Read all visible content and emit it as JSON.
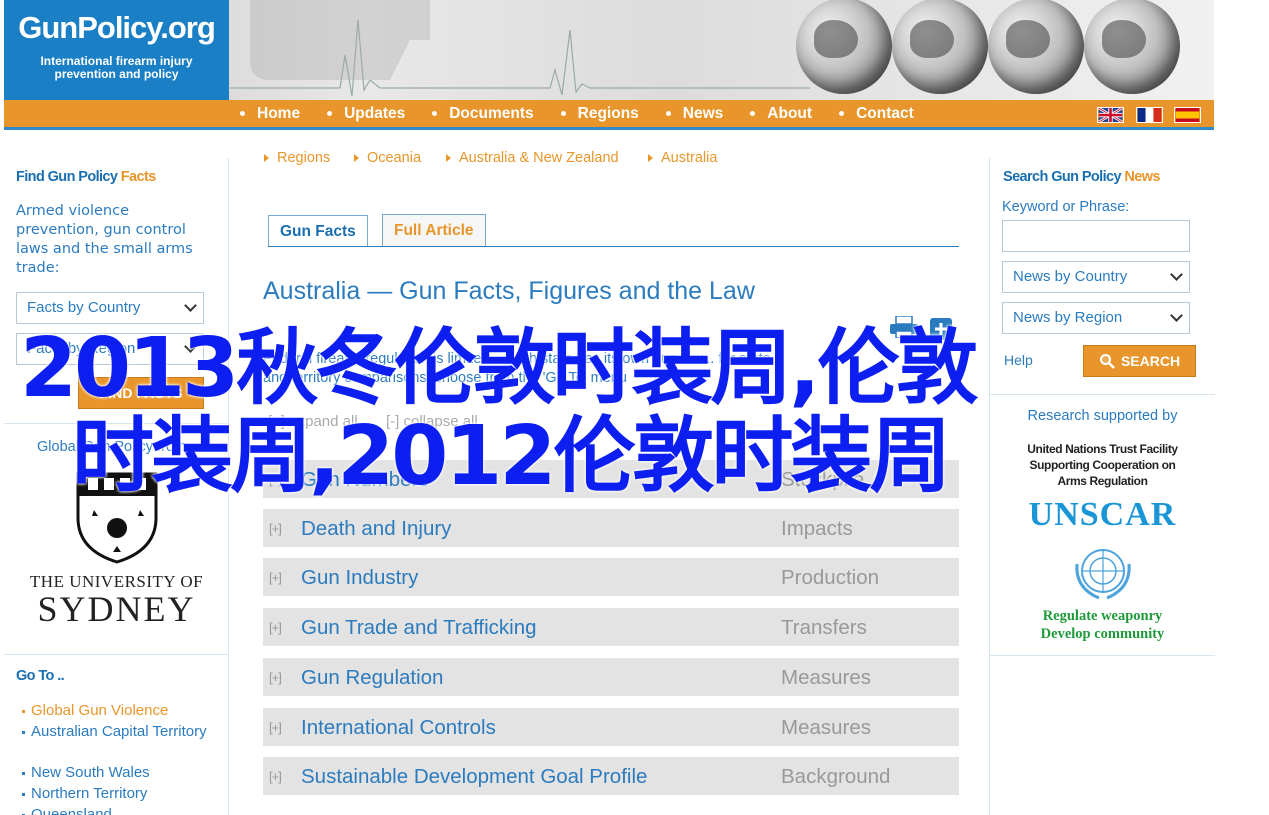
{
  "logo": {
    "title": "GunPolicy.org",
    "tagline_line1": "International firearm injury",
    "tagline_line2": "prevention and policy"
  },
  "nav": {
    "items": [
      "Home",
      "Updates",
      "Documents",
      "Regions",
      "News",
      "About",
      "Contact"
    ]
  },
  "flags": [
    "english-flag",
    "french-flag",
    "spanish-flag"
  ],
  "left": {
    "find_title_a": "Find Gun Policy ",
    "find_title_b": "Facts",
    "find_desc": "Armed violence prevention, gun control laws and the small arms trade:",
    "select1": "Facts by Country",
    "select2": "Facts by Region",
    "find_button": "FIND FACTS",
    "global_label": "Global Gun Policy from",
    "uni_line1": "THE UNIVERSITY OF",
    "uni_line2": "SYDNEY",
    "goto_title": "Go To ..",
    "goto_items": [
      "Global Gun Violence",
      "Australian Capital Territory",
      "New South Wales",
      "Northern Territory",
      "Queensland"
    ]
  },
  "breadcrumb": [
    "Regions",
    "Oceania",
    "Australia & New Zealand",
    "Australia"
  ],
  "tabs": [
    "Gun Facts",
    "Full Article"
  ],
  "page_title": "Australia — Gun Facts, Figures and the Law",
  "intro": "Federal firearm regulation is limited... each state has its own gun law... for state and territory comparisons, choose from the 'Go To' menu",
  "expand": "expand all",
  "collapse": "collapse all",
  "rows": [
    {
      "label": "Gun Numbers",
      "cat": "Stockpile"
    },
    {
      "label": "Death and Injury",
      "cat": "Impacts"
    },
    {
      "label": "Gun Industry",
      "cat": "Production"
    },
    {
      "label": "Gun Trade and Trafficking",
      "cat": "Transfers"
    },
    {
      "label": "Gun Regulation",
      "cat": "Measures"
    },
    {
      "label": "International Controls",
      "cat": "Measures"
    },
    {
      "label": "Sustainable Development Goal Profile",
      "cat": "Background"
    }
  ],
  "right": {
    "search_title_a": "Search Gun Policy ",
    "search_title_b": "News",
    "keyword_label": "Keyword or Phrase:",
    "keyword_value": "",
    "select1": "News by Country",
    "select2": "News by Region",
    "search_button": "SEARCH",
    "help": "Help",
    "research": "Research supported by",
    "un_line1": "United Nations Trust Facility",
    "un_line2": "Supporting Cooperation on",
    "un_line3": "Arms Regulation",
    "unscar": "UNSCAR",
    "reg1": "Regulate weaponry",
    "reg2": "Develop community"
  },
  "overlay": {
    "line1": "2013秋冬伦敦时装周,伦敦",
    "line2": "时装周,2012伦敦时装周"
  },
  "colors": {
    "brand_blue": "#1a7fc4",
    "nav_orange": "#e8962b",
    "link_blue": "#2b7bbf",
    "overlay_blue": "#0d1ff0"
  }
}
